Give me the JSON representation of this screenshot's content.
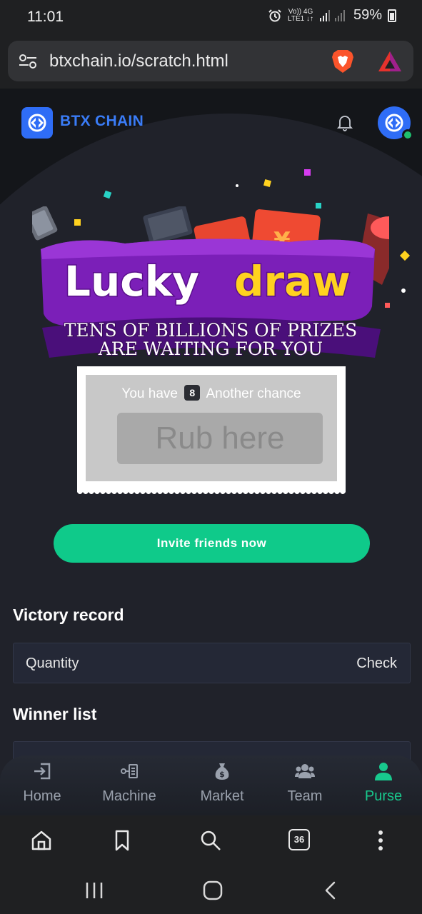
{
  "status_bar": {
    "time": "11:01",
    "net_top": "Vo)) 4G",
    "net_bottom": "LTE1 ↓↑",
    "battery": "59%"
  },
  "browser": {
    "url": "btxchain.io/scratch.html",
    "tab_count": "36"
  },
  "header": {
    "brand": "BTX CHAIN"
  },
  "banner": {
    "title_word1": "Lucky",
    "title_word2": "draw",
    "subtitle_line1": "TENS OF BILLIONS OF PRIZES",
    "subtitle_line2": "ARE WAITING FOR YOU"
  },
  "scratch_card": {
    "prefix": "You have",
    "chances": "8",
    "suffix": "Another chance",
    "rub_label": "Rub here"
  },
  "invite_button": "Invite friends now",
  "victory_record": {
    "heading": "Victory record",
    "left": "Quantity",
    "right": "Check"
  },
  "winner_list": {
    "heading": "Winner list"
  },
  "tab_bar": [
    {
      "label": "Home",
      "icon": "login-icon"
    },
    {
      "label": "Machine",
      "icon": "machine-icon"
    },
    {
      "label": "Market",
      "icon": "money-bag-icon"
    },
    {
      "label": "Team",
      "icon": "team-icon"
    },
    {
      "label": "Purse",
      "icon": "user-icon",
      "active": true
    }
  ],
  "colors": {
    "brand_blue": "#2f6df6",
    "accent_green": "#0fca8a",
    "banner_purple": "#7b1fb8",
    "banner_yellow": "#ffd21f"
  }
}
